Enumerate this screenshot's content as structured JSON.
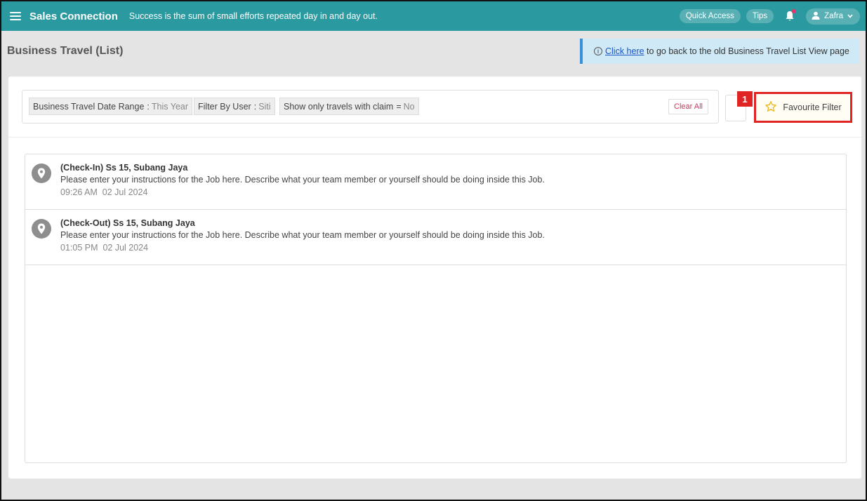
{
  "header": {
    "brand": "Sales Connection",
    "tagline": "Success is the sum of small efforts repeated day in and day out.",
    "quick_access": "Quick Access",
    "tips": "Tips",
    "user_name": "Zafra",
    "icons": [
      "menu-icon",
      "bell-icon",
      "user-icon",
      "chevron-down-icon"
    ]
  },
  "page": {
    "title": "Business Travel (List)"
  },
  "banner": {
    "info_glyph": "i",
    "link_text": "Click here",
    "rest_text": " to go back to the old Business Travel List View page"
  },
  "filters": {
    "chips": [
      {
        "label": "Business Travel Date Range",
        "sep": ":",
        "value": "This Year"
      },
      {
        "label": "Filter By User",
        "sep": ":",
        "value": "Siti"
      },
      {
        "label": "Show only travels with claim",
        "sep": "=",
        "value": "No"
      }
    ],
    "clear_all": "Clear All",
    "favourite": "Favourite Filter",
    "annotation_number": "1"
  },
  "items": [
    {
      "title": "(Check-In) Ss 15, Subang Jaya",
      "description": "Please enter your instructions for the Job here. Describe what your team member or yourself should be doing inside this Job.",
      "time": "09:26 AM  02 Jul 2024"
    },
    {
      "title": "(Check-Out) Ss 15, Subang Jaya",
      "description": "Please enter your instructions for the Job here. Describe what your team member or yourself should be doing inside this Job.",
      "time": "01:05 PM  02 Jul 2024"
    }
  ],
  "colors": {
    "topbar": "#2a9aa0",
    "annotation_red": "#e02424",
    "banner_bg": "#cfe9f6",
    "star": "#f2b51d"
  }
}
